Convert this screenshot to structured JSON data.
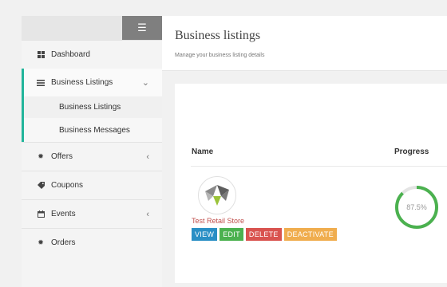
{
  "sidebar": {
    "toggle_icon": "hamburger-menu-icon",
    "items": [
      {
        "label": "Dashboard",
        "icon": "grid-icon"
      },
      {
        "label": "Business Listings",
        "icon": "list-icon",
        "chevron": "chevron-down-icon"
      },
      {
        "label": "Offers",
        "icon": "gear-icon",
        "chevron": "chevron-left-icon"
      },
      {
        "label": "Coupons",
        "icon": "tag-icon"
      },
      {
        "label": "Events",
        "icon": "calendar-icon",
        "chevron": "chevron-left-icon"
      },
      {
        "label": "Orders",
        "icon": "gear-icon"
      }
    ],
    "submenu": [
      "Business Listings",
      "Business Messages"
    ]
  },
  "header": {
    "title": "Business listings",
    "subtitle": "Manage your business listing details"
  },
  "table": {
    "columns": [
      "Name",
      "Progress"
    ],
    "rows": [
      {
        "name": "Test Retail Store",
        "progress_label": "87.5%",
        "progress": 0.875,
        "actions": [
          "VIEW",
          "EDIT",
          "DELETE",
          "DEACTIVATE"
        ]
      }
    ]
  },
  "colors": {
    "accent": "#22b59b",
    "view": "#2a8fc5",
    "edit": "#4bb14f",
    "delete": "#d9534f",
    "deactivate": "#f0ad4e",
    "progress": "#4bb14f",
    "store_name": "#c0504d"
  }
}
